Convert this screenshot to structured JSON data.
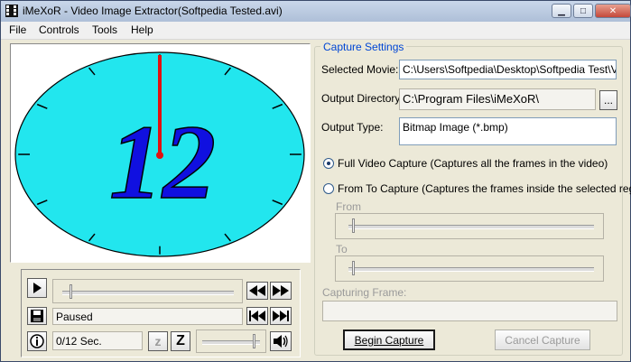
{
  "window": {
    "title": "iMeXoR - Video Image Extractor(Softpedia Tested.avi)",
    "close_glyph": "✕",
    "min_glyph": "▁",
    "max_glyph": "□"
  },
  "menu": {
    "items": [
      "File",
      "Controls",
      "Tools",
      "Help"
    ]
  },
  "preview": {
    "clock_number": "12",
    "clock_face_color": "#22e6ee",
    "hand_color": "#e21010",
    "number_color": "#1010e0"
  },
  "player": {
    "status": "Paused",
    "time": "0/12 Sec.",
    "zoom_small_label": "z",
    "zoom_large_label": "Z",
    "info_label": "i"
  },
  "capture": {
    "group_title": "Capture Settings",
    "selected_movie_label": "Selected Movie:",
    "selected_movie_value": "C:\\Users\\Softpedia\\Desktop\\Softpedia Test\\Vide",
    "output_dir_label": "Output Directory:",
    "output_dir_value": "C:\\Program Files\\iMeXoR\\",
    "browse_label": "...",
    "output_type_label": "Output Type:",
    "output_type_value": "Bitmap Image (*.bmp)",
    "full_capture_label": "Full Video Capture (Captures all the frames in the video)",
    "from_to_label": "From To Capture (Captures the frames inside the selected region)",
    "from_label": "From",
    "to_label": "To",
    "capturing_frame_label": "Capturing Frame:",
    "begin_button": "Begin Capture",
    "cancel_button": "Cancel Capture"
  }
}
